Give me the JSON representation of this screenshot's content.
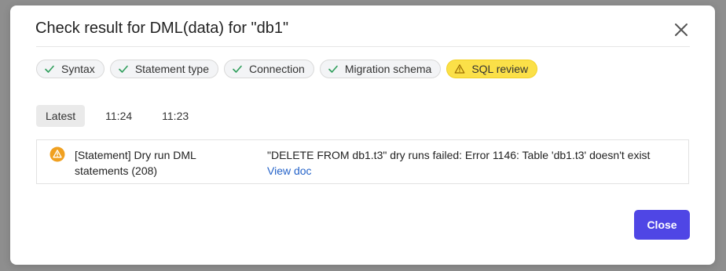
{
  "dialog": {
    "title": "Check result for DML(data) for \"db1\"",
    "close_icon": "close-icon",
    "checks": [
      {
        "label": "Syntax",
        "status": "success",
        "icon": "check-icon"
      },
      {
        "label": "Statement type",
        "status": "success",
        "icon": "check-icon"
      },
      {
        "label": "Connection",
        "status": "success",
        "icon": "check-icon"
      },
      {
        "label": "Migration schema",
        "status": "success",
        "icon": "check-icon"
      },
      {
        "label": "SQL review",
        "status": "warning",
        "icon": "warning-triangle-icon"
      }
    ],
    "tabs": [
      {
        "label": "Latest",
        "active": true
      },
      {
        "label": "11:24",
        "active": false
      },
      {
        "label": "11:23",
        "active": false
      }
    ],
    "result": {
      "icon": "warning-icon",
      "title": "[Statement] Dry run DML statements (208)",
      "message": "\"DELETE FROM db1.t3\" dry runs failed: Error 1146: Table 'db1.t3' doesn't exist",
      "link": "View doc"
    },
    "close_button": "Close"
  },
  "colors": {
    "success": "#2f9e5b",
    "warning_chip": "#fbe048",
    "warning_icon": "#f0a020",
    "primary": "#4f46e5",
    "link": "#2563c9"
  }
}
